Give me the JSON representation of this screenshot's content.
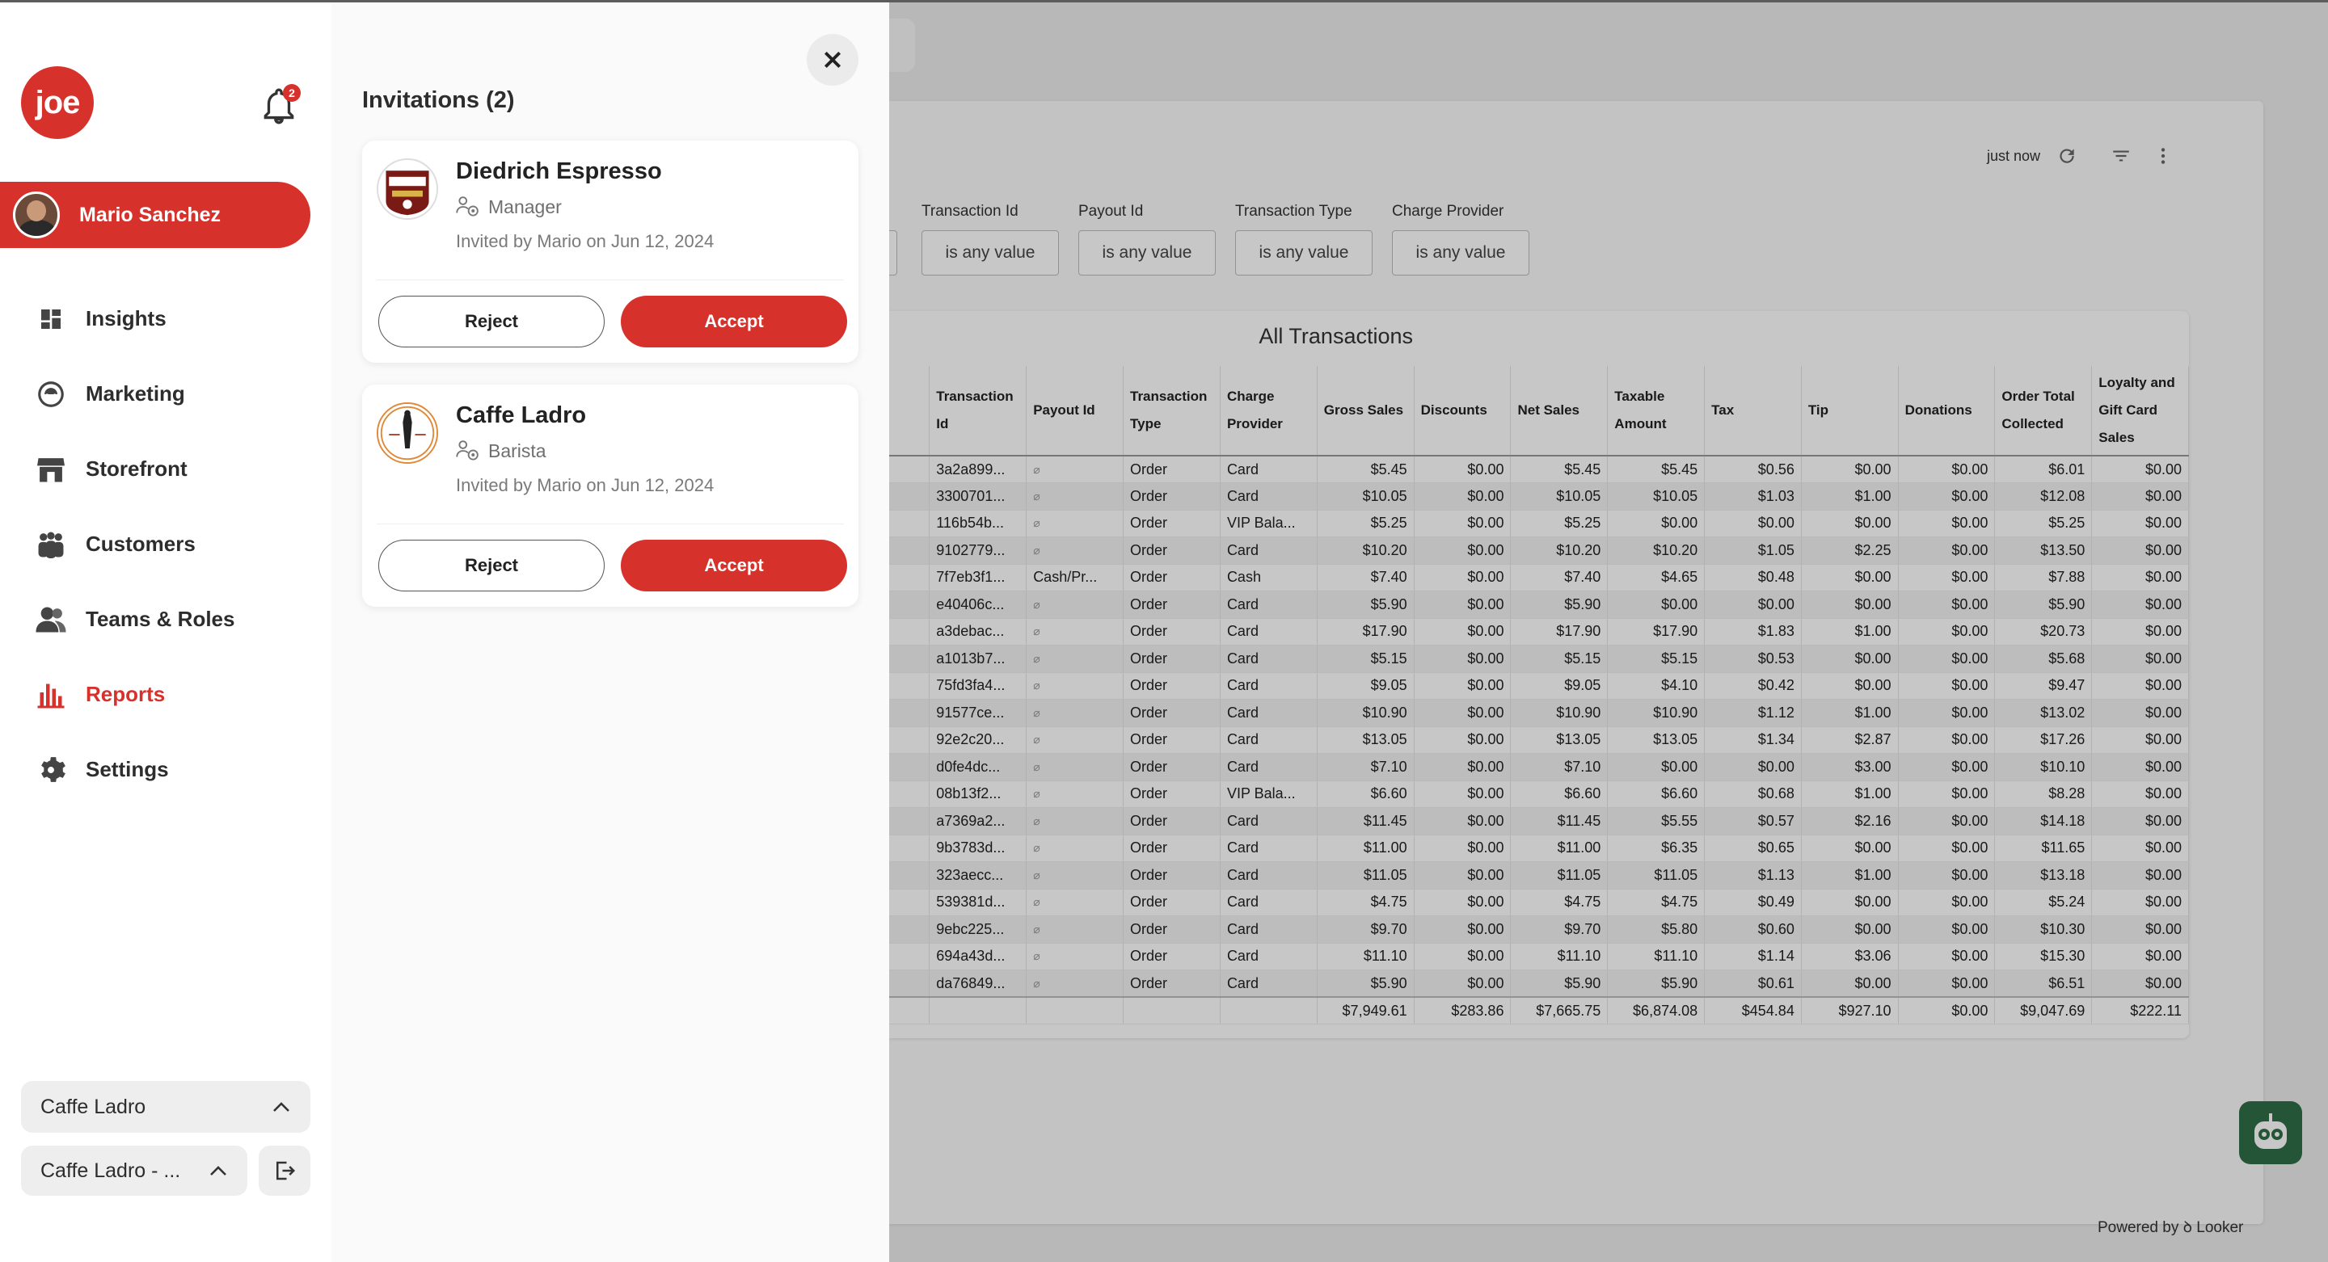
{
  "sidebar": {
    "logo_text": "joe",
    "notification_count": "2",
    "user_name": "Mario Sanchez",
    "nav": [
      {
        "label": "Insights",
        "icon": "dashboard-icon"
      },
      {
        "label": "Marketing",
        "icon": "marketing-icon"
      },
      {
        "label": "Storefront",
        "icon": "storefront-icon"
      },
      {
        "label": "Customers",
        "icon": "customers-icon"
      },
      {
        "label": "Teams & Roles",
        "icon": "teams-icon"
      },
      {
        "label": "Reports",
        "icon": "reports-icon",
        "active": true
      },
      {
        "label": "Settings",
        "icon": "gear-icon"
      }
    ],
    "business_select": "Caffe Ladro",
    "location_select": "Caffe Ladro - ..."
  },
  "invitations": {
    "title": "Invitations (2)",
    "items": [
      {
        "business": "Diedrich Espresso",
        "role": "Manager",
        "invited": "Invited by Mario on Jun 12, 2024",
        "reject": "Reject",
        "accept": "Accept"
      },
      {
        "business": "Caffe Ladro",
        "role": "Barista",
        "invited": "Invited by Mario on Jun 12, 2024",
        "reject": "Reject",
        "accept": "Accept"
      }
    ]
  },
  "dashboard": {
    "updated": "just now",
    "filters": [
      {
        "label": "Transaction Id",
        "value": "is any value"
      },
      {
        "label": "Payout Id",
        "value": "is any value"
      },
      {
        "label": "Transaction Type",
        "value": "is any value"
      },
      {
        "label": "Charge Provider",
        "value": "is any value"
      }
    ],
    "table_title": "All Transactions",
    "columns": [
      "Transaction Id",
      "Payout Id",
      "Transaction Type",
      "Charge Provider",
      "Gross Sales",
      "Discounts",
      "Net Sales",
      "Taxable Amount",
      "Tax",
      "Tip",
      "Donations",
      "Order Total Collected",
      "Loyalty and Gift Card Sales"
    ],
    "rows": [
      [
        "3a2a899...",
        "⌀",
        "Order",
        "Card",
        "$5.45",
        "$0.00",
        "$5.45",
        "$5.45",
        "$0.56",
        "$0.00",
        "$0.00",
        "$6.01",
        "$0.00"
      ],
      [
        "3300701...",
        "⌀",
        "Order",
        "Card",
        "$10.05",
        "$0.00",
        "$10.05",
        "$10.05",
        "$1.03",
        "$1.00",
        "$0.00",
        "$12.08",
        "$0.00"
      ],
      [
        "116b54b...",
        "⌀",
        "Order",
        "VIP Bala...",
        "$5.25",
        "$0.00",
        "$5.25",
        "$0.00",
        "$0.00",
        "$0.00",
        "$0.00",
        "$5.25",
        "$0.00"
      ],
      [
        "9102779...",
        "⌀",
        "Order",
        "Card",
        "$10.20",
        "$0.00",
        "$10.20",
        "$10.20",
        "$1.05",
        "$2.25",
        "$0.00",
        "$13.50",
        "$0.00"
      ],
      [
        "7f7eb3f1...",
        "Cash/Pr...",
        "Order",
        "Cash",
        "$7.40",
        "$0.00",
        "$7.40",
        "$4.65",
        "$0.48",
        "$0.00",
        "$0.00",
        "$7.88",
        "$0.00"
      ],
      [
        "e40406c...",
        "⌀",
        "Order",
        "Card",
        "$5.90",
        "$0.00",
        "$5.90",
        "$0.00",
        "$0.00",
        "$0.00",
        "$0.00",
        "$5.90",
        "$0.00"
      ],
      [
        "a3debac...",
        "⌀",
        "Order",
        "Card",
        "$17.90",
        "$0.00",
        "$17.90",
        "$17.90",
        "$1.83",
        "$1.00",
        "$0.00",
        "$20.73",
        "$0.00"
      ],
      [
        "a1013b7...",
        "⌀",
        "Order",
        "Card",
        "$5.15",
        "$0.00",
        "$5.15",
        "$5.15",
        "$0.53",
        "$0.00",
        "$0.00",
        "$5.68",
        "$0.00"
      ],
      [
        "75fd3fa4...",
        "⌀",
        "Order",
        "Card",
        "$9.05",
        "$0.00",
        "$9.05",
        "$4.10",
        "$0.42",
        "$0.00",
        "$0.00",
        "$9.47",
        "$0.00"
      ],
      [
        "91577ce...",
        "⌀",
        "Order",
        "Card",
        "$10.90",
        "$0.00",
        "$10.90",
        "$10.90",
        "$1.12",
        "$1.00",
        "$0.00",
        "$13.02",
        "$0.00"
      ],
      [
        "92e2c20...",
        "⌀",
        "Order",
        "Card",
        "$13.05",
        "$0.00",
        "$13.05",
        "$13.05",
        "$1.34",
        "$2.87",
        "$0.00",
        "$17.26",
        "$0.00"
      ],
      [
        "d0fe4dc...",
        "⌀",
        "Order",
        "Card",
        "$7.10",
        "$0.00",
        "$7.10",
        "$0.00",
        "$0.00",
        "$3.00",
        "$0.00",
        "$10.10",
        "$0.00"
      ],
      [
        "08b13f2...",
        "⌀",
        "Order",
        "VIP Bala...",
        "$6.60",
        "$0.00",
        "$6.60",
        "$6.60",
        "$0.68",
        "$1.00",
        "$0.00",
        "$8.28",
        "$0.00"
      ],
      [
        "a7369a2...",
        "⌀",
        "Order",
        "Card",
        "$11.45",
        "$0.00",
        "$11.45",
        "$5.55",
        "$0.57",
        "$2.16",
        "$0.00",
        "$14.18",
        "$0.00"
      ],
      [
        "9b3783d...",
        "⌀",
        "Order",
        "Card",
        "$11.00",
        "$0.00",
        "$11.00",
        "$6.35",
        "$0.65",
        "$0.00",
        "$0.00",
        "$11.65",
        "$0.00"
      ],
      [
        "323aecc...",
        "⌀",
        "Order",
        "Card",
        "$11.05",
        "$0.00",
        "$11.05",
        "$11.05",
        "$1.13",
        "$1.00",
        "$0.00",
        "$13.18",
        "$0.00"
      ],
      [
        "539381d...",
        "⌀",
        "Order",
        "Card",
        "$4.75",
        "$0.00",
        "$4.75",
        "$4.75",
        "$0.49",
        "$0.00",
        "$0.00",
        "$5.24",
        "$0.00"
      ],
      [
        "9ebc225...",
        "⌀",
        "Order",
        "Card",
        "$9.70",
        "$0.00",
        "$9.70",
        "$5.80",
        "$0.60",
        "$0.00",
        "$0.00",
        "$10.30",
        "$0.00"
      ],
      [
        "694a43d...",
        "⌀",
        "Order",
        "Card",
        "$11.10",
        "$0.00",
        "$11.10",
        "$11.10",
        "$1.14",
        "$3.06",
        "$0.00",
        "$15.30",
        "$0.00"
      ],
      [
        "da76849...",
        "⌀",
        "Order",
        "Card",
        "$5.90",
        "$0.00",
        "$5.90",
        "$5.90",
        "$0.61",
        "$0.00",
        "$0.00",
        "$6.51",
        "$0.00"
      ]
    ],
    "totals": [
      "",
      "",
      "",
      "",
      "$7,949.61",
      "$283.86",
      "$7,665.75",
      "$6,874.08",
      "$454.84",
      "$927.10",
      "$0.00",
      "$9,047.69",
      "$222.11"
    ],
    "powered_by": "Powered by ꝺ Looker"
  },
  "colors": {
    "brand": "#d6312b",
    "panel": "#fafafa"
  }
}
